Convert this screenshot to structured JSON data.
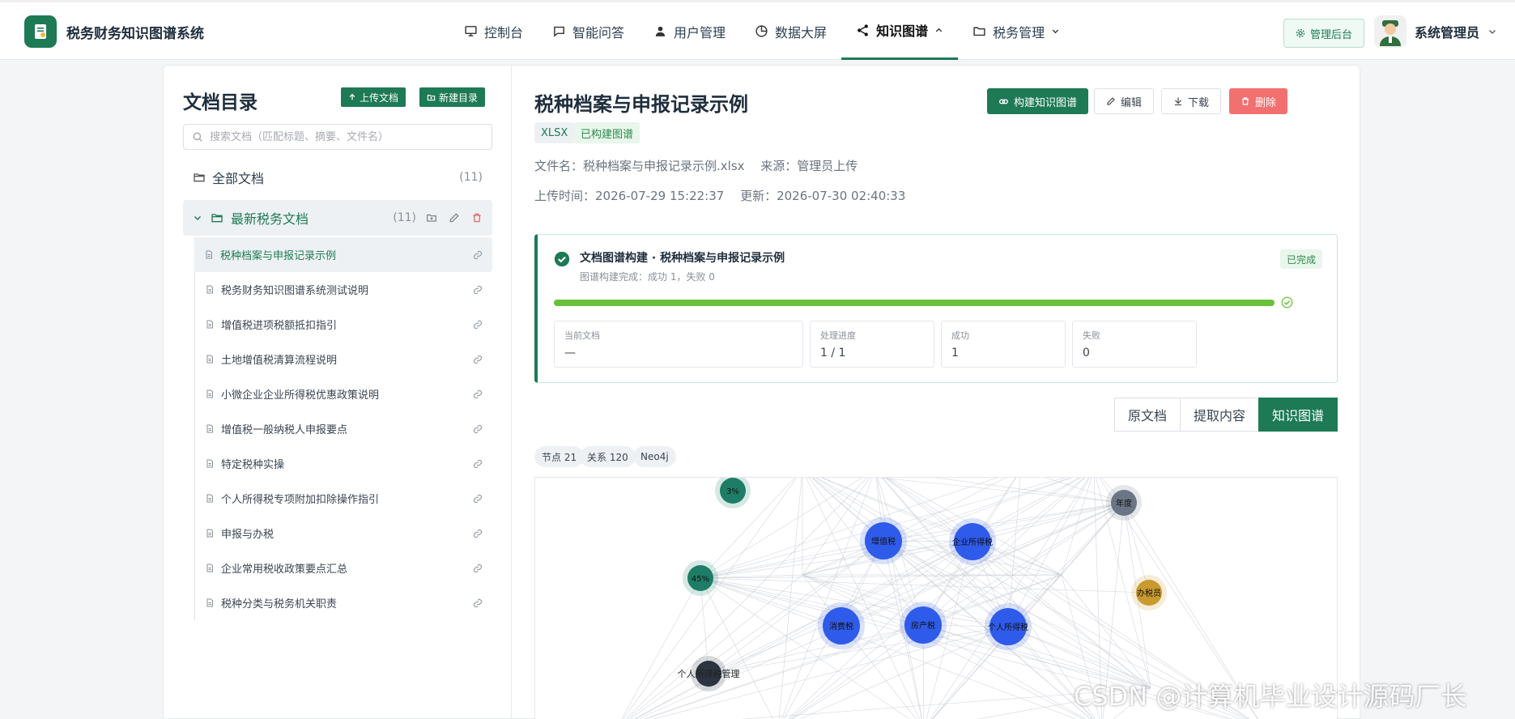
{
  "app": {
    "title": "税务财务知识图谱系统"
  },
  "nav": {
    "items": [
      {
        "label": "控制台"
      },
      {
        "label": "智能问答"
      },
      {
        "label": "用户管理"
      },
      {
        "label": "数据大屏"
      },
      {
        "label": "知识图谱"
      },
      {
        "label": "税务管理"
      }
    ],
    "active": "知识图谱",
    "admin_button": "管理后台",
    "user_name": "系统管理员"
  },
  "sidebar": {
    "title": "文档目录",
    "upload_button": "上传文档",
    "new_folder_button": "新建目录",
    "search_placeholder": "搜索文档（匹配标题、摘要、文件名）",
    "all_docs": {
      "label": "全部文档",
      "count": "(11)"
    },
    "folder": {
      "label": "最新税务文档",
      "count": "(11)"
    },
    "documents": [
      "税种档案与申报记录示例",
      "税务财务知识图谱系统测试说明",
      "增值税进项税额抵扣指引",
      "土地增值税清算流程说明",
      "小微企业企业所得税优惠政策说明",
      "增值税一般纳税人申报要点",
      "特定税种实操",
      "个人所得税专项附加扣除操作指引",
      "申报与办税",
      "企业常用税收政策要点汇总",
      "税种分类与税务机关职责"
    ]
  },
  "document": {
    "title": "税种档案与申报记录示例",
    "tags": {
      "type": "XLSX",
      "status": "已构建图谱"
    },
    "file_line": "文件名：税种档案与申报记录示例.xlsx　 来源：管理员上传",
    "time_line": "上传时间：2026-07-29 15:22:37　 更新：2026-07-30 02:40:33",
    "actions": {
      "build": "构建知识图谱",
      "edit": "编辑",
      "download": "下载",
      "delete": "删除"
    }
  },
  "build_status": {
    "title": "文档图谱构建 · 税种档案与申报记录示例",
    "subtitle": "图谱构建完成：成功 1，失败 0",
    "badge": "已完成",
    "progress": 1.0,
    "stats": [
      {
        "label": "当前文档",
        "value": "—"
      },
      {
        "label": "处理进度",
        "value": "1 / 1"
      },
      {
        "label": "成功",
        "value": "1"
      },
      {
        "label": "失败",
        "value": "0"
      }
    ]
  },
  "view_tabs": [
    "原文档",
    "提取内容",
    "知识图谱"
  ],
  "active_tab": "知识图谱",
  "graph_stats": [
    "节点 21",
    "关系 120",
    "Neo4j"
  ],
  "graph": {
    "nodes": [
      {
        "label": "3%",
        "color": "#1e7d67"
      },
      {
        "label": "45%",
        "color": "#1e7d67"
      },
      {
        "label": "年度",
        "color": "#6b7585"
      },
      {
        "label": "办税员",
        "color": "#c99a2e"
      },
      {
        "label": "增值税",
        "color": "#2f5bea"
      },
      {
        "label": "企业所得税",
        "color": "#2f5bea"
      },
      {
        "label": "消费税",
        "color": "#2f5bea"
      },
      {
        "label": "房产税",
        "color": "#2f5bea"
      },
      {
        "label": "个人所得税",
        "color": "#2f5bea"
      },
      {
        "label": "个人所得税管理",
        "color": "#2b3440"
      }
    ]
  },
  "watermark": "CSDN @计算机毕业设计源码厂长"
}
